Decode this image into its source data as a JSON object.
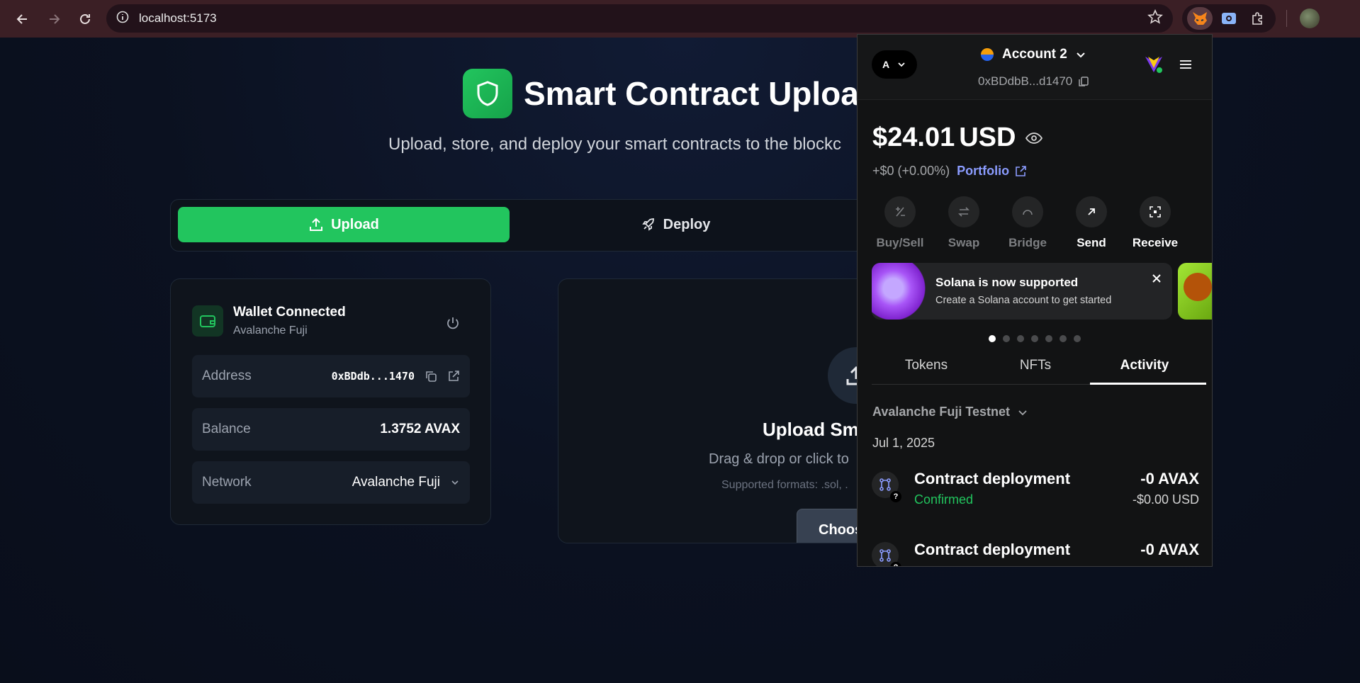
{
  "browser": {
    "url": "localhost:5173"
  },
  "app": {
    "title": "Smart Contract Upload",
    "subtitle": "Upload, store, and deploy your smart contracts to the blockc",
    "tabs": [
      {
        "label": "Upload",
        "active": true
      },
      {
        "label": "Deploy",
        "active": false
      }
    ],
    "accent": "#22c55e"
  },
  "wallet_card": {
    "title": "Wallet Connected",
    "network_sub": "Avalanche Fuji",
    "rows": {
      "address": {
        "label": "Address",
        "value": "0xBDdb...1470"
      },
      "balance": {
        "label": "Balance",
        "value": "1.3752 AVAX"
      },
      "network": {
        "label": "Network",
        "value": "Avalanche Fuji"
      }
    }
  },
  "upload_card": {
    "title": "Upload Sma",
    "drag_text": "Drag & drop or click to",
    "formats": "Supported formats: .sol, .",
    "button": "Choos"
  },
  "wallet_popup": {
    "account_pill": "A",
    "account_name": "Account 2",
    "address": "0xBDdbB...d1470",
    "balance_amount": "$24.01",
    "balance_currency": "USD",
    "change": "+$0 (+0.00%)",
    "portfolio_link": "Portfolio",
    "actions": [
      {
        "label": "Buy/Sell",
        "icon": "buy-sell-icon",
        "enabled": false
      },
      {
        "label": "Swap",
        "icon": "swap-icon",
        "enabled": false
      },
      {
        "label": "Bridge",
        "icon": "bridge-icon",
        "enabled": false
      },
      {
        "label": "Send",
        "icon": "send-icon",
        "enabled": true
      },
      {
        "label": "Receive",
        "icon": "receive-icon",
        "enabled": true
      }
    ],
    "banner": {
      "title": "Solana is now supported",
      "body": "Create a Solana account to get started"
    },
    "carousel_dots": 7,
    "carousel_active": 0,
    "tabs": [
      {
        "label": "Tokens",
        "active": false
      },
      {
        "label": "NFTs",
        "active": false
      },
      {
        "label": "Activity",
        "active": true
      }
    ],
    "network_filter": "Avalanche Fuji Testnet",
    "date": "Jul 1, 2025",
    "transactions": [
      {
        "name": "Contract deployment",
        "status": "Confirmed",
        "amount": "-0 AVAX",
        "usd": "-$0.00 USD"
      },
      {
        "name": "Contract deployment",
        "status": "",
        "amount": "-0 AVAX",
        "usd": ""
      }
    ]
  }
}
